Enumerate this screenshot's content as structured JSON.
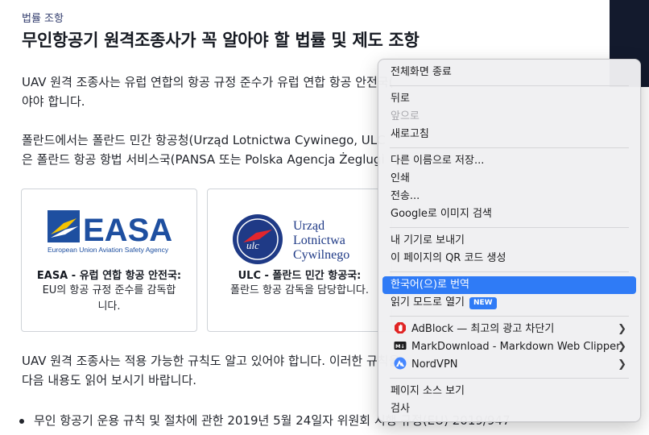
{
  "breadcrumb": "법률 조항",
  "title": "무인항공기 원격조종사가 꼭 알아야 할 법률 및 제도 조항",
  "paragraphs": {
    "p1_line1": "UAV 원격 조종사는 유럽 연합의 항공 규정 준수가 유럽 연합 항공 안전국(",
    "p1_line2": "야야 합니다.",
    "p2_line1": "폴란드에서는 폴란드 민간 항공청(Urząd Lotnictwa Cywinego, ULC",
    "p2_line2": "은 폴란드 항공 항법 서비스국(PANSA 또는 Polska Agencja Żeglugi",
    "p3_line1": "UAV 원격 조종사는 적용 가능한 규칙도 알고 있어야 합니다. 이러한 규칙을",
    "p3_line2": "다음 내용도 읽어 보시기 바랍니다."
  },
  "cards": {
    "easa": {
      "logo_text": "EASA",
      "logo_subtext": "European Union Aviation Safety Agency",
      "title": "EASA - 유럽 연합 항공 안전국:",
      "desc": "EU의 항공 규정 준수를 감독합니다."
    },
    "ulc": {
      "logo_line1": "Urząd",
      "logo_line2": "Lotnictwa",
      "logo_line3": "Cywilnego",
      "title": "ULC - 폴란드 민간 항공국:",
      "desc": "폴란드 항공 감독을 담당합니다."
    }
  },
  "bullet1": "무인 항공기 운용 규칙 및 절차에 관한 2019년 5월 24일자 위원회 시행 규정(EU) 2019/947",
  "context_menu": {
    "exit_fullscreen": "전체화면 종료",
    "back": "뒤로",
    "forward": "앞으로",
    "reload": "새로고침",
    "save_as": "다른 이름으로 저장...",
    "print": "인쇄",
    "cast": "전송...",
    "google_image_search": "Google로 이미지 검색",
    "send_to_devices": "내 기기로 보내기",
    "qr_code": "이 페이지의 QR 코드 생성",
    "translate": "한국어(으)로 번역",
    "reading_mode": "읽기 모드로 열기",
    "new_badge": "NEW",
    "adblock": "AdBlock — 최고의 광고 차단기",
    "markdownload": "MarkDownload - Markdown Web Clipper",
    "nordvpn": "NordVPN",
    "view_source": "페이지 소스 보기",
    "inspect": "검사"
  },
  "icons": {
    "adblock": "adblock-icon",
    "markdownload": "markdown-icon",
    "nordvpn": "nordvpn-icon",
    "submenu": "chevron-right-icon"
  },
  "colors": {
    "highlight": "#2f7bf6",
    "easa_blue": "#1e4fa0",
    "easa_yellow": "#f5c300",
    "dark_panel": "#131a2d"
  }
}
